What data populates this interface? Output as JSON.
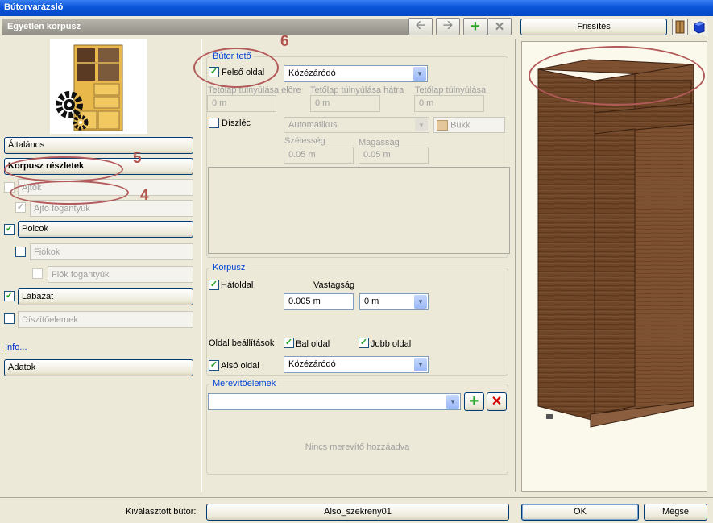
{
  "window": {
    "title": "Bútorvarázsló"
  },
  "header": {
    "title": "Egyetlen korpusz"
  },
  "toolbar": {
    "back_icon": "arrow-left-icon",
    "forward_icon": "arrow-right-icon",
    "add_icon": "plus-icon",
    "delete_icon": "x-icon"
  },
  "right_top": {
    "refresh_label": "Frissítés"
  },
  "sidebar": {
    "general": "Általános",
    "corpus_details": "Korpusz részletek",
    "doors": "Ajtók",
    "door_handles": "Ajtó fogantyúk",
    "shelves": "Polcok",
    "drawers": "Fiókok",
    "drawer_handles": "Fiók fogantyúk",
    "base": "Lábazat",
    "decor": "Díszítőelemek",
    "info": "Info...",
    "data": "Adatok"
  },
  "top_group": {
    "title": "Bútor tető",
    "top_side_label": "Felső oldal",
    "top_side_value": "Közézáródó",
    "overhang_front_label": "Tetőlap túlnyúlása előre",
    "overhang_back_label": "Tetőlap túlnyúlása hátra",
    "overhang_label": "Tetőlap túlnyúlása",
    "overhang_front_value": "0 m",
    "overhang_back_value": "0 m",
    "overhang_value": "0 m",
    "cornice_label": "Díszléc",
    "cornice_mode": "Automatikus",
    "material": "Bükk",
    "width_label": "Szélesség",
    "height_label": "Magasság",
    "width_value": "0.05 m",
    "height_value": "0.05 m"
  },
  "corpus_group": {
    "title": "Korpusz",
    "back_label": "Hátoldal",
    "thickness_label": "Vastagság",
    "thickness_value": "0.005 m",
    "thickness_select": "0 m",
    "side_settings_label": "Oldal beállítások",
    "left_side_label": "Bal oldal",
    "right_side_label": "Jobb oldal",
    "bottom_side_label": "Alsó oldal",
    "bottom_side_value": "Közézáródó"
  },
  "stiffeners": {
    "title": "Merevítőelemek",
    "empty_text": "Nincs merevítő hozzáadva"
  },
  "annotations": {
    "n4": "4",
    "n5": "5",
    "n6": "6"
  },
  "footer": {
    "selected_label": "Kiválasztott bútor:",
    "selected_value": "Also_szekreny01",
    "ok": "OK",
    "cancel": "Mégse"
  },
  "colors": {
    "title_blue": "#0A55D8",
    "group_title": "#0046d5",
    "annotation": "#b2524d",
    "wood": "#6b4427"
  }
}
